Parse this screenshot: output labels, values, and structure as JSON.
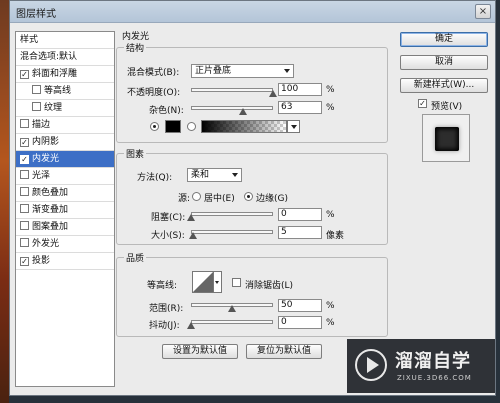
{
  "dialog": {
    "title": "图层样式",
    "close_symbol": "×"
  },
  "styles_panel": {
    "header": "样式",
    "blending_default": "混合选项:默认",
    "items": [
      {
        "label": "斜面和浮雕",
        "checked": true,
        "indent": false
      },
      {
        "label": "等高线",
        "checked": false,
        "indent": true
      },
      {
        "label": "纹理",
        "checked": false,
        "indent": true
      },
      {
        "label": "描边",
        "checked": false,
        "indent": false
      },
      {
        "label": "内阴影",
        "checked": true,
        "indent": false
      },
      {
        "label": "内发光",
        "checked": true,
        "indent": false,
        "selected": true
      },
      {
        "label": "光泽",
        "checked": false,
        "indent": false
      },
      {
        "label": "颜色叠加",
        "checked": false,
        "indent": false
      },
      {
        "label": "渐变叠加",
        "checked": false,
        "indent": false
      },
      {
        "label": "图案叠加",
        "checked": false,
        "indent": false
      },
      {
        "label": "外发光",
        "checked": false,
        "indent": false
      },
      {
        "label": "投影",
        "checked": true,
        "indent": false
      }
    ]
  },
  "inner_glow": {
    "title": "内发光",
    "structure": {
      "title": "结构",
      "blend_mode_label": "混合模式(B):",
      "blend_mode_value": "正片叠底",
      "opacity_label": "不透明度(O):",
      "opacity_value": "100",
      "opacity_unit": "%",
      "opacity": 100,
      "noise_label": "杂色(N):",
      "noise_value": "63",
      "noise_unit": "%",
      "noise": 63,
      "color_mode": "solid",
      "glow_color": "#000000"
    },
    "elements": {
      "title": "图素",
      "technique_label": "方法(Q):",
      "technique_value": "柔和",
      "source_label": "源:",
      "source_center": "居中(E)",
      "source_edge": "边缘(G)",
      "source_selected": "edge",
      "choke_label": "阻塞(C):",
      "choke_value": "0",
      "choke_unit": "%",
      "choke": 0,
      "size_label": "大小(S):",
      "size_value": "5",
      "size_unit": "像素",
      "size": 5
    },
    "quality": {
      "title": "品质",
      "contour_label": "等高线:",
      "antialias_label": "消除锯齿(L)",
      "antialias_checked": false,
      "range_label": "范围(R):",
      "range_value": "50",
      "range_unit": "%",
      "range": 50,
      "jitter_label": "抖动(J):",
      "jitter_value": "0",
      "jitter_unit": "%",
      "jitter": 0
    },
    "make_default": "设置为默认值",
    "reset_default": "复位为默认值"
  },
  "buttons": {
    "ok": "确定",
    "cancel": "取消",
    "new_style": "新建样式(W)...",
    "preview_label": "预览(V)",
    "preview_checked": true
  },
  "watermark": {
    "brand": "溜溜自学",
    "url": "ZIXUE.3D66.COM"
  }
}
